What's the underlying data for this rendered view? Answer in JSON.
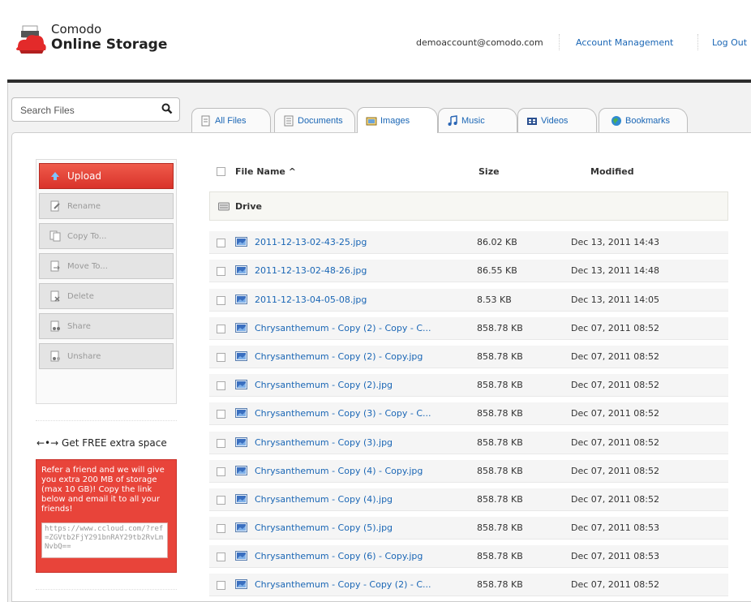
{
  "header": {
    "brand_line1": "Comodo",
    "brand_line2": "Online Storage",
    "email": "demoaccount@comodo.com",
    "account_management": "Account Management",
    "logout": "Log Out"
  },
  "search": {
    "placeholder": "Search Files"
  },
  "tabs": [
    {
      "label": "All Files",
      "icon": "all-files-icon"
    },
    {
      "label": "Documents",
      "icon": "documents-icon"
    },
    {
      "label": "Images",
      "icon": "images-icon",
      "active": true
    },
    {
      "label": "Music",
      "icon": "music-icon"
    },
    {
      "label": "Videos",
      "icon": "videos-icon"
    },
    {
      "label": "Bookmarks",
      "icon": "bookmarks-icon"
    }
  ],
  "actions": {
    "upload": "Upload",
    "rename": "Rename",
    "copy_to": "Copy To...",
    "move_to": "Move To...",
    "delete": "Delete",
    "share": "Share",
    "unshare": "Unshare"
  },
  "promo": {
    "title": "Get FREE extra space",
    "text": "Refer a friend and we will give you extra 200 MB of storage (max 10 GB)! Copy the link below and email it to all your friends!",
    "link": "https://www.ccloud.com/?ref=ZGVtb2FjY291bnRAY29tb2RvLmNvbQ=="
  },
  "list": {
    "col_file": "File Name ^",
    "col_size": "Size",
    "col_modified": "Modified",
    "drive": "Drive",
    "rows": [
      {
        "name": "2011-12-13-02-43-25.jpg",
        "size": "86.02 KB",
        "modified": "Dec 13, 2011 14:43"
      },
      {
        "name": "2011-12-13-02-48-26.jpg",
        "size": "86.55 KB",
        "modified": "Dec 13, 2011 14:48"
      },
      {
        "name": "2011-12-13-04-05-08.jpg",
        "size": "8.53 KB",
        "modified": "Dec 13, 2011 14:05"
      },
      {
        "name": "Chrysanthemum - Copy (2) - Copy - C...",
        "size": "858.78 KB",
        "modified": "Dec 07, 2011 08:52"
      },
      {
        "name": "Chrysanthemum - Copy (2) - Copy.jpg",
        "size": "858.78 KB",
        "modified": "Dec 07, 2011 08:52"
      },
      {
        "name": "Chrysanthemum - Copy (2).jpg",
        "size": "858.78 KB",
        "modified": "Dec 07, 2011 08:52"
      },
      {
        "name": "Chrysanthemum - Copy (3) - Copy - C...",
        "size": "858.78 KB",
        "modified": "Dec 07, 2011 08:52"
      },
      {
        "name": "Chrysanthemum - Copy (3).jpg",
        "size": "858.78 KB",
        "modified": "Dec 07, 2011 08:52"
      },
      {
        "name": "Chrysanthemum - Copy (4) - Copy.jpg",
        "size": "858.78 KB",
        "modified": "Dec 07, 2011 08:52"
      },
      {
        "name": "Chrysanthemum - Copy (4).jpg",
        "size": "858.78 KB",
        "modified": "Dec 07, 2011 08:52"
      },
      {
        "name": "Chrysanthemum - Copy (5).jpg",
        "size": "858.78 KB",
        "modified": "Dec 07, 2011 08:53"
      },
      {
        "name": "Chrysanthemum - Copy (6) - Copy.jpg",
        "size": "858.78 KB",
        "modified": "Dec 07, 2011 08:53"
      },
      {
        "name": "Chrysanthemum - Copy - Copy (2) - C...",
        "size": "858.78 KB",
        "modified": "Dec 07, 2011 08:52"
      }
    ]
  }
}
